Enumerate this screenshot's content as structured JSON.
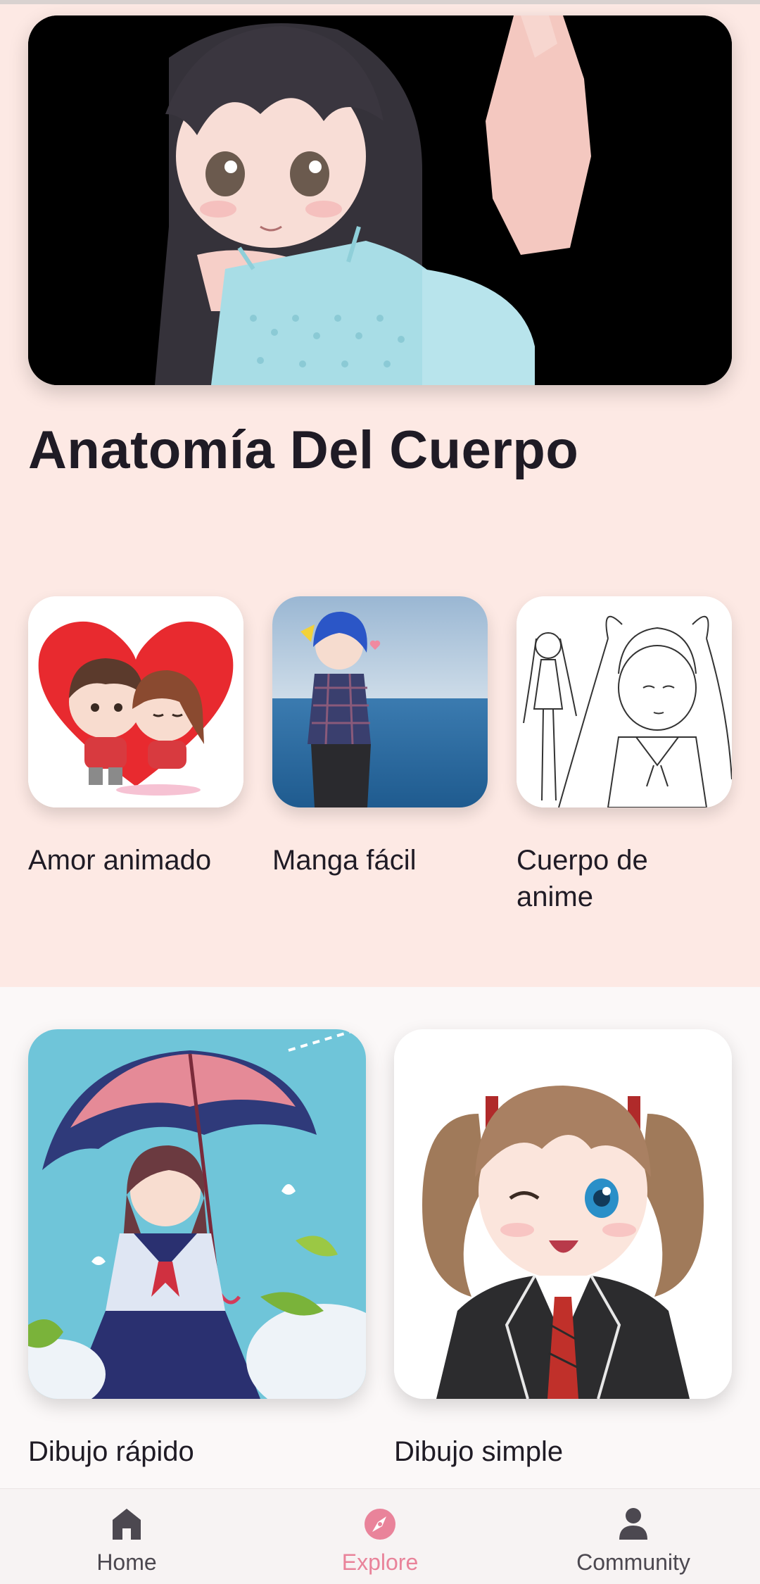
{
  "hero": {
    "image": "anime-girl-lying-illustration"
  },
  "section": {
    "title": "Anatomía Del Cuerpo"
  },
  "categories": [
    {
      "label": "Amor animado",
      "image": "chibi-couple-heart-illustration"
    },
    {
      "label": "Manga fácil",
      "image": "manga-girl-by-sea-illustration"
    },
    {
      "label": "Cuerpo de anime",
      "image": "anime-body-line-art-illustration"
    }
  ],
  "featured": [
    {
      "label": "Dibujo rápido",
      "image": "girl-with-umbrella-illustration"
    },
    {
      "label": "Dibujo simple",
      "image": "winking-twin-tails-girl-illustration"
    }
  ],
  "nav": {
    "items": [
      {
        "label": "Home",
        "icon": "home-icon",
        "active": false
      },
      {
        "label": "Explore",
        "icon": "compass-icon",
        "active": true
      },
      {
        "label": "Community",
        "icon": "person-icon",
        "active": false
      }
    ]
  },
  "colors": {
    "background_pink": "#fde9e4",
    "accent": "#e9839a",
    "text_dark": "#1f1b25"
  }
}
